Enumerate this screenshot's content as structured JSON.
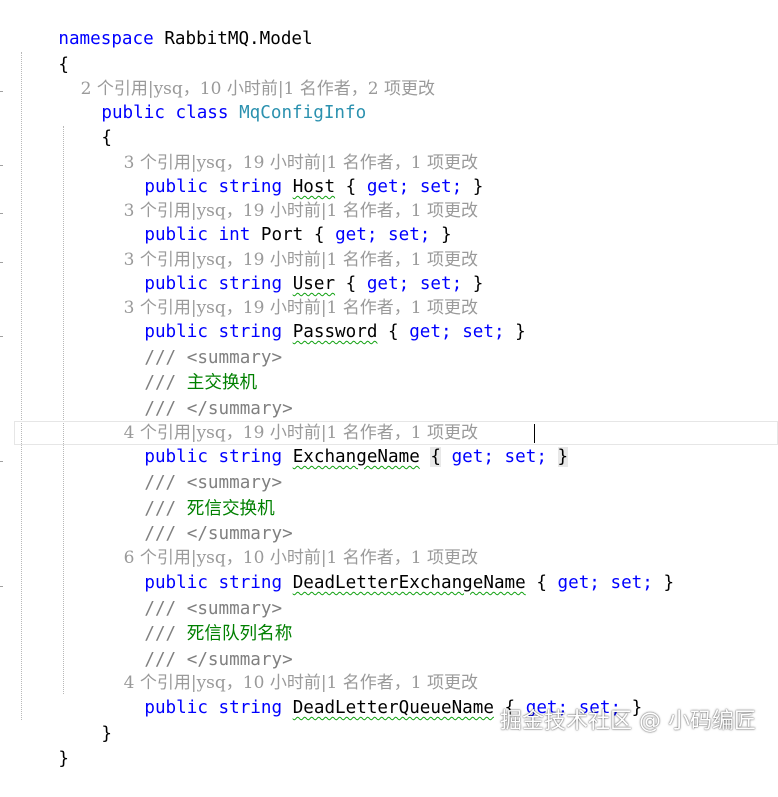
{
  "code": {
    "namespace_kw": "namespace",
    "namespace_name": "RabbitMQ.Model",
    "open_brace": "{",
    "close_brace": "}",
    "class_lens": "2 个引用|ysq，10 小时前|1 名作者，2 项更改",
    "class_public": "public",
    "class_kw": "class",
    "class_name": "MqConfigInfo",
    "class_open": "{",
    "class_close": "}",
    "summary_open": "/// <summary>",
    "summary_close": "/// </summary>",
    "comment_prefix": "/// ",
    "accessor": "{ get; set; }",
    "accessor_get": "get;",
    "accessor_set": "set;",
    "brace_l": "{",
    "brace_r": "}",
    "properties": [
      {
        "lens": "3 个引用|ysq，19 小时前|1 名作者，1 项更改",
        "modifier": "public",
        "type": "string",
        "name": "Host",
        "comment": ""
      },
      {
        "lens": "3 个引用|ysq，19 小时前|1 名作者，1 项更改",
        "modifier": "public",
        "type": "int",
        "name": "Port",
        "comment": ""
      },
      {
        "lens": "3 个引用|ysq，19 小时前|1 名作者，1 项更改",
        "modifier": "public",
        "type": "string",
        "name": "User",
        "comment": ""
      },
      {
        "lens": "3 个引用|ysq，19 小时前|1 名作者，1 项更改",
        "modifier": "public",
        "type": "string",
        "name": "Password",
        "comment": ""
      },
      {
        "lens": "4 个引用|ysq，19 小时前|1 名作者，1 项更改",
        "modifier": "public",
        "type": "string",
        "name": "ExchangeName",
        "comment": "主交换机"
      },
      {
        "lens": "6 个引用|ysq，10 小时前|1 名作者，1 项更改",
        "modifier": "public",
        "type": "string",
        "name": "DeadLetterExchangeName",
        "comment": "死信交换机"
      },
      {
        "lens": "4 个引用|ysq，10 小时前|1 名作者，1 项更改",
        "modifier": "public",
        "type": "string",
        "name": "DeadLetterQueueName",
        "comment": "死信队列名称"
      }
    ]
  },
  "watermark": "掘金技术社区 @ 小码编匠",
  "colors": {
    "keyword": "#0000ff",
    "type_name": "#2b91af",
    "comment_text": "#008000",
    "comment_tag": "#808080",
    "codelens": "#9a9a9a",
    "squiggle": "#10a010"
  }
}
